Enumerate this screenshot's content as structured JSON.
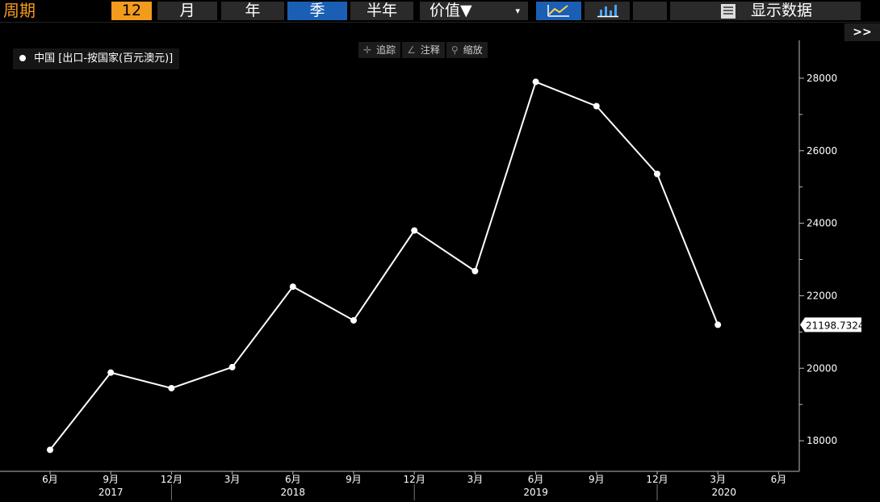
{
  "toolbar": {
    "period_label": "周期",
    "count": "12",
    "btn_month": "月",
    "btn_year": "年",
    "btn_quarter": "季",
    "btn_halfyear": "半年",
    "value_dropdown": "价值▼",
    "dropdown_arrow": "▾",
    "show_data": "显示数据",
    "expand": ">>"
  },
  "chart_tools": {
    "track": "追踪",
    "annotate": "注释",
    "zoom": "缩放"
  },
  "legend": {
    "series_label": "中国 [出口-按国家(百元澳元)]"
  },
  "last_value_label": "21198.7324",
  "chart_data": {
    "type": "line",
    "series": [
      {
        "name": "中国 [出口-按国家(百元澳元)]",
        "x": [
          "2017-06",
          "2017-09",
          "2017-12",
          "2018-03",
          "2018-06",
          "2018-09",
          "2018-12",
          "2019-03",
          "2019-06",
          "2019-09",
          "2019-12",
          "2020-03"
        ],
        "values": [
          17750,
          19880,
          19450,
          20030,
          22250,
          21320,
          23800,
          22680,
          27900,
          27230,
          25360,
          21198.7324
        ]
      }
    ],
    "x_tick_labels": [
      "6月",
      "9月",
      "12月",
      "3月",
      "6月",
      "9月",
      "12月",
      "3月",
      "6月",
      "9月",
      "12月",
      "3月",
      "6月"
    ],
    "year_labels": [
      "2017",
      "2018",
      "2019",
      "2020"
    ],
    "y_ticks": [
      18000,
      20000,
      22000,
      24000,
      26000,
      28000
    ],
    "ylim": [
      16800,
      29000
    ],
    "line_color": "#ffffff",
    "background": "#000000"
  }
}
